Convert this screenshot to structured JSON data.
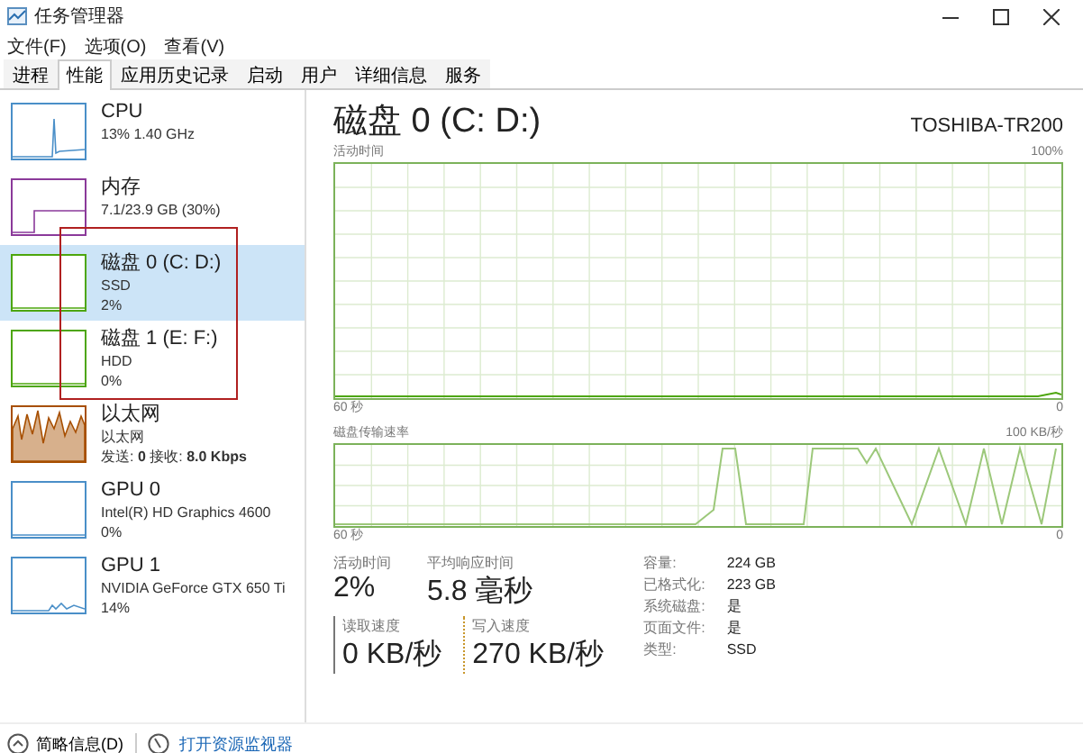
{
  "window": {
    "title": "任务管理器"
  },
  "menu": [
    "文件(F)",
    "选项(O)",
    "查看(V)"
  ],
  "tabs": [
    {
      "label": "进程",
      "selected": false
    },
    {
      "label": "性能",
      "selected": true
    },
    {
      "label": "应用历史记录",
      "selected": false
    },
    {
      "label": "启动",
      "selected": false
    },
    {
      "label": "用户",
      "selected": false
    },
    {
      "label": "详细信息",
      "selected": false
    },
    {
      "label": "服务",
      "selected": false
    }
  ],
  "sidebar": {
    "items": [
      {
        "name": "CPU",
        "lines": [
          "13% 1.40 GHz"
        ],
        "selected": false,
        "color": "#4a8fc8"
      },
      {
        "name": "内存",
        "lines": [
          "7.1/23.9 GB (30%)"
        ],
        "selected": false,
        "color": "#8b3a9a"
      },
      {
        "name": "磁盘 0 (C: D:)",
        "lines": [
          "SSD",
          "2%"
        ],
        "selected": true,
        "color": "#4da60c"
      },
      {
        "name": "磁盘 1 (E: F:)",
        "lines": [
          "HDD",
          "0%"
        ],
        "selected": false,
        "color": "#4da60c"
      },
      {
        "name": "以太网",
        "lines": [
          "以太网",
          "发送: **0** 接收: **8.0 Kbps**"
        ],
        "selected": false,
        "color": "#a74f01"
      },
      {
        "name": "GPU 0",
        "lines": [
          "Intel(R) HD Graphics 4600",
          "0%"
        ],
        "selected": false,
        "color": "#4a8fc8"
      },
      {
        "name": "GPU 1",
        "lines": [
          "NVIDIA GeForce GTX 650 Ti",
          "14%"
        ],
        "selected": false,
        "color": "#4a8fc8"
      }
    ]
  },
  "detail": {
    "title": "磁盘 0 (C: D:)",
    "model": "TOSHIBA-TR200",
    "activity_chart": {
      "label": "活动时间",
      "max": "100%",
      "time_span": "60 秒",
      "min": "0"
    },
    "transfer_chart": {
      "label": "磁盘传输速率",
      "max": "100 KB/秒",
      "time_span": "60 秒",
      "min": "0"
    },
    "stats": [
      {
        "label": "活动时间",
        "value": "2%"
      },
      {
        "label": "平均响应时间",
        "value": "5.8 毫秒"
      }
    ],
    "rates": [
      {
        "label": "读取速度",
        "value": "0 KB/秒",
        "kind": "read"
      },
      {
        "label": "写入速度",
        "value": "270 KB/秒",
        "kind": "write"
      }
    ],
    "properties": [
      {
        "label": "容量:",
        "value": "224 GB"
      },
      {
        "label": "已格式化:",
        "value": "223 GB"
      },
      {
        "label": "系统磁盘:",
        "value": "是"
      },
      {
        "label": "页面文件:",
        "value": "是"
      },
      {
        "label": "类型:",
        "value": "SSD"
      }
    ]
  },
  "footer": {
    "details_toggle": "简略信息(D)",
    "monitor_link": "打开资源监视器"
  }
}
